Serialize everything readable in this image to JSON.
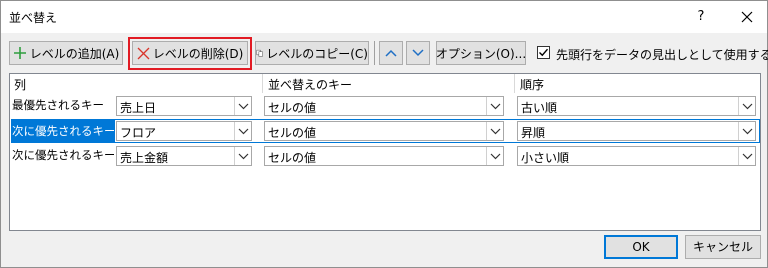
{
  "window": {
    "title": "並べ替え",
    "help_label": "?"
  },
  "toolbar": {
    "add_level_label": "レベルの追加(A)",
    "delete_level_label": "レベルの削除(D)",
    "copy_level_label": "レベルのコピー(C)",
    "options_label": "オプション(O)...",
    "has_header_checkbox_label": "先頭行をデータの見出しとして使用する(H)",
    "has_header_checked": true
  },
  "grid": {
    "headers": {
      "column": "列",
      "sort_on": "並べ替えのキー",
      "order": "順序"
    },
    "rows": [
      {
        "label": "最優先されるキー",
        "column": "売上日",
        "sort_on": "セルの値",
        "order": "古い順"
      },
      {
        "label": "次に優先されるキー",
        "column": "フロア",
        "sort_on": "セルの値",
        "order": "昇順"
      },
      {
        "label": "次に優先されるキー",
        "column": "売上金額",
        "sort_on": "セルの値",
        "order": "小さい順"
      }
    ]
  },
  "footer": {
    "ok_label": "OK",
    "cancel_label": "キャンセル"
  },
  "colors": {
    "accent": "#0078d7",
    "highlight_border": "#e21b24",
    "add_plus": "#2e9e3e",
    "delete_x": "#d9352b"
  }
}
